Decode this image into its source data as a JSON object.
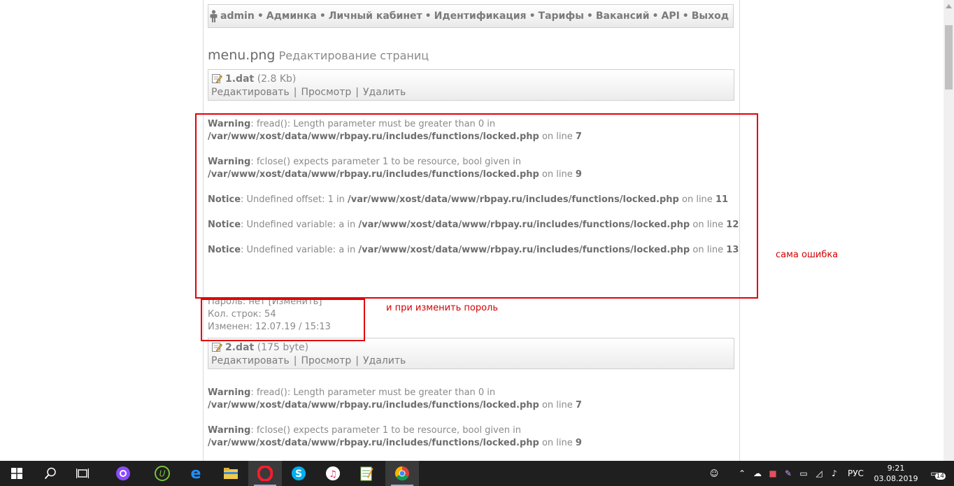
{
  "nav": {
    "items": [
      "admin",
      "Админка",
      "Личный кабинет",
      "Идентификация",
      "Тарифы",
      "Вакансий",
      "API",
      "Выход"
    ],
    "separator": "•"
  },
  "title": {
    "main": "menu.png",
    "sub": "Редактирование страниц"
  },
  "files": [
    {
      "name": "1.dat",
      "size": "(2.8 Kb)",
      "actions": [
        "Редактировать",
        "Просмотр",
        "Удалить"
      ]
    },
    {
      "name": "2.dat",
      "size": "(175 byte)",
      "actions": [
        "Редактировать",
        "Просмотр",
        "Удалить"
      ]
    }
  ],
  "messages1": [
    {
      "level": "Warning",
      "text": ": fread(): Length parameter must be greater than 0 in ",
      "path": "/var/www/xost/data/www/rbpay.ru/includes/functions/locked.php",
      "on": " on line ",
      "line": "7"
    },
    {
      "level": "Warning",
      "text": ": fclose() expects parameter 1 to be resource, bool given in ",
      "path": "/var/www/xost/data/www/rbpay.ru/includes/functions/locked.php",
      "on": " on line ",
      "line": "9"
    },
    {
      "level": "Notice",
      "text": ": Undefined offset: 1 in ",
      "path": "/var/www/xost/data/www/rbpay.ru/includes/functions/locked.php",
      "on": " on line ",
      "line": "11"
    },
    {
      "level": "Notice",
      "text": ": Undefined variable: a in ",
      "path": "/var/www/xost/data/www/rbpay.ru/includes/functions/locked.php",
      "on": " on line ",
      "line": "12"
    },
    {
      "level": "Notice",
      "text": ": Undefined variable: a in ",
      "path": "/var/www/xost/data/www/rbpay.ru/includes/functions/locked.php",
      "on": " on line ",
      "line": "13"
    }
  ],
  "messages2": [
    {
      "level": "Warning",
      "text": ": fread(): Length parameter must be greater than 0 in ",
      "path": "/var/www/xost/data/www/rbpay.ru/includes/functions/locked.php",
      "on": " on line ",
      "line": "7"
    },
    {
      "level": "Warning",
      "text": ": fclose() expects parameter 1 to be resource, bool given in ",
      "path": "/var/www/xost/data/www/rbpay.ru/includes/functions/locked.php",
      "on": " on line ",
      "line": "9"
    }
  ],
  "info": {
    "password": "Пароль: нет [Изменить]",
    "rows": "Кол. строк: 54",
    "changed": "Изменен: 12.07.19 / 15:13"
  },
  "annotations": {
    "error": "сама ошибка",
    "password": "и при изменить пороль"
  },
  "taskbar": {
    "lang": "РУС",
    "time": "9:21",
    "date": "03.08.2019",
    "notifications": "14",
    "icons": [
      "windows-start-icon",
      "search-icon",
      "task-view-icon",
      "alice-icon",
      "utorrent-icon",
      "edge-icon",
      "file-explorer-icon",
      "opera-icon",
      "skype-icon",
      "itunes-icon",
      "notepad-icon",
      "chrome-icon"
    ]
  },
  "colors": {
    "accent_red": "#e0000a",
    "text_gray": "#8a8a8a",
    "taskbar": "#1f1f1f"
  }
}
